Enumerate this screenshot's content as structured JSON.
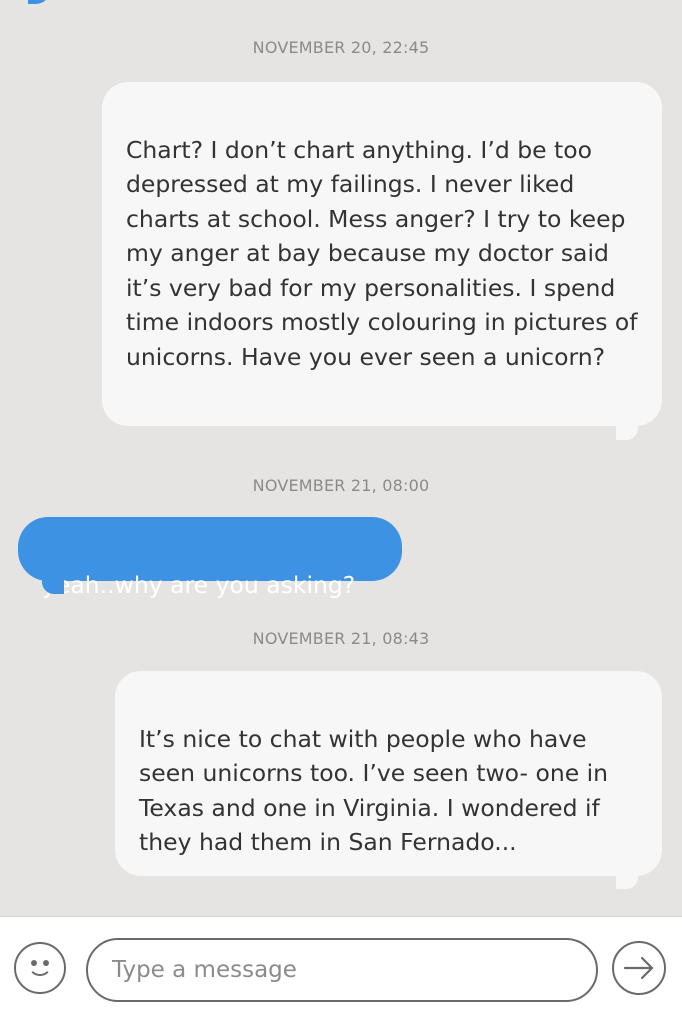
{
  "colors": {
    "background": "#e6e4e3",
    "incoming_bubble": "#f7f7f7",
    "outgoing_bubble": "#3d92e3",
    "timestamp_text": "#8c8a89"
  },
  "conversation": {
    "timestamps": [
      "NOVEMBER 20, 22:45",
      "NOVEMBER 21, 08:00",
      "NOVEMBER 21, 08:43"
    ],
    "messages": [
      {
        "direction": "incoming",
        "text": "Chart? I don’t chart anything. I’d be too depressed at my failings. I never liked charts at school.  Mess anger? I try to keep my anger at bay  because my doctor said it’s very bad for my personalities. I spend time indoors mostly colouring in pictures of unicorns. Have you ever seen a unicorn?"
      },
      {
        "direction": "outgoing",
        "text": "yeah..why are you asking?"
      },
      {
        "direction": "incoming",
        "text": "It’s nice to chat with people who have seen unicorns too. I’ve seen two- one in Texas and one in Virginia. I wondered if they had them in San Fernado..."
      }
    ]
  },
  "composer": {
    "placeholder": "Type a message",
    "value": "",
    "emoji_icon": "smiley-face-icon",
    "send_icon": "arrow-right-icon"
  }
}
